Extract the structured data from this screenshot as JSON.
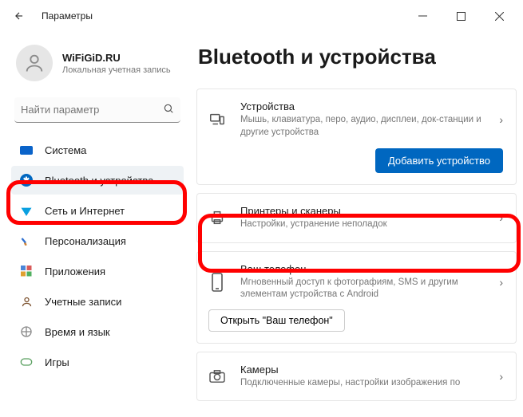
{
  "window": {
    "title": "Параметры"
  },
  "user": {
    "name": "WiFiGiD.RU",
    "subtitle": "Локальная учетная запись"
  },
  "search": {
    "placeholder": "Найти параметр"
  },
  "sidebar": {
    "items": [
      {
        "label": "Система"
      },
      {
        "label": "Bluetooth и устройства"
      },
      {
        "label": "Сеть и Интернет"
      },
      {
        "label": "Персонализация"
      },
      {
        "label": "Приложения"
      },
      {
        "label": "Учетные записи"
      },
      {
        "label": "Время и язык"
      },
      {
        "label": "Игры"
      }
    ]
  },
  "page": {
    "title": "Bluetooth и устройства"
  },
  "cards": {
    "devices": {
      "title": "Устройства",
      "subtitle": "Мышь, клавиатура, перо, аудио, дисплеи, док-станции и другие устройства",
      "add_button": "Добавить устройство"
    },
    "printers": {
      "title": "Принтеры и сканеры",
      "subtitle": "Настройки, устранение неполадок"
    },
    "phone": {
      "title": "Ваш телефон",
      "subtitle": "Мгновенный доступ к фотографиям, SMS и другим элементам устройства с Android",
      "open_button": "Открыть \"Ваш телефон\""
    },
    "cameras": {
      "title": "Камеры",
      "subtitle": "Подключенные камеры, настройки изображения по"
    }
  }
}
